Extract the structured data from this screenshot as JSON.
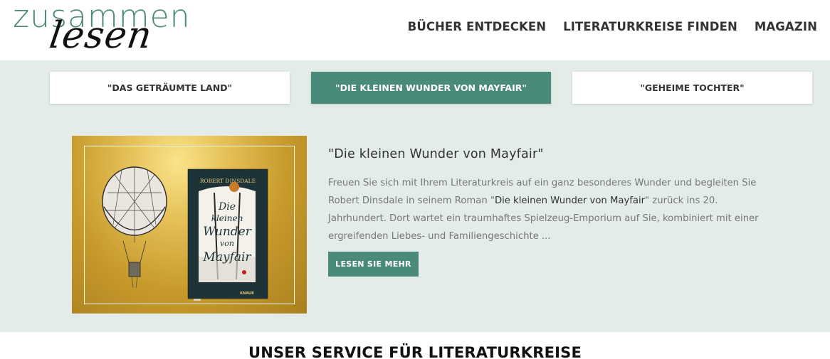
{
  "logo": {
    "line1": "zusammen",
    "line2": "lesen"
  },
  "nav": {
    "items": [
      "BÜCHER ENTDECKEN",
      "LITERATURKREISE FINDEN",
      "MAGAZIN"
    ]
  },
  "tabs": [
    {
      "label": "\"DAS GETRÄUMTE LAND\""
    },
    {
      "label": "\"DIE KLEINEN WUNDER VON MAYFAIR\""
    },
    {
      "label": "\"GEHEIME TOCHTER\""
    }
  ],
  "teaser": {
    "title": "\"Die kleinen Wunder von Mayfair\"",
    "text_part1": "Freuen Sie sich mit Ihrem Literaturkreis auf ein ganz besonderes Wunder und begleiten Sie Robert Dinsdale in seinem Roman \"",
    "text_link": "Die kleinen Wunder von Mayfair",
    "text_part2": "\" zurück ins 20. Jahrhundert. Dort wartet ein traumhaftes Spielzeug-Emporium auf Sie, kombiniert mit einer ergreifenden Liebes- und Familiengeschichte ...",
    "button": "LESEN SIE MEHR",
    "book": {
      "author": "ROBERT DINSDALE",
      "title_line1": "Die",
      "title_line2": "kleinen",
      "title_line3": "Wunder",
      "title_line4": "von",
      "title_line5": "Mayfair",
      "publisher": "KNAUR"
    }
  },
  "section": {
    "heading": "UNSER SERVICE FÜR LITERATURKREISE"
  },
  "colors": {
    "accent": "#4a8a7b",
    "band": "#e3ece8",
    "gold": "#c79a2c"
  }
}
